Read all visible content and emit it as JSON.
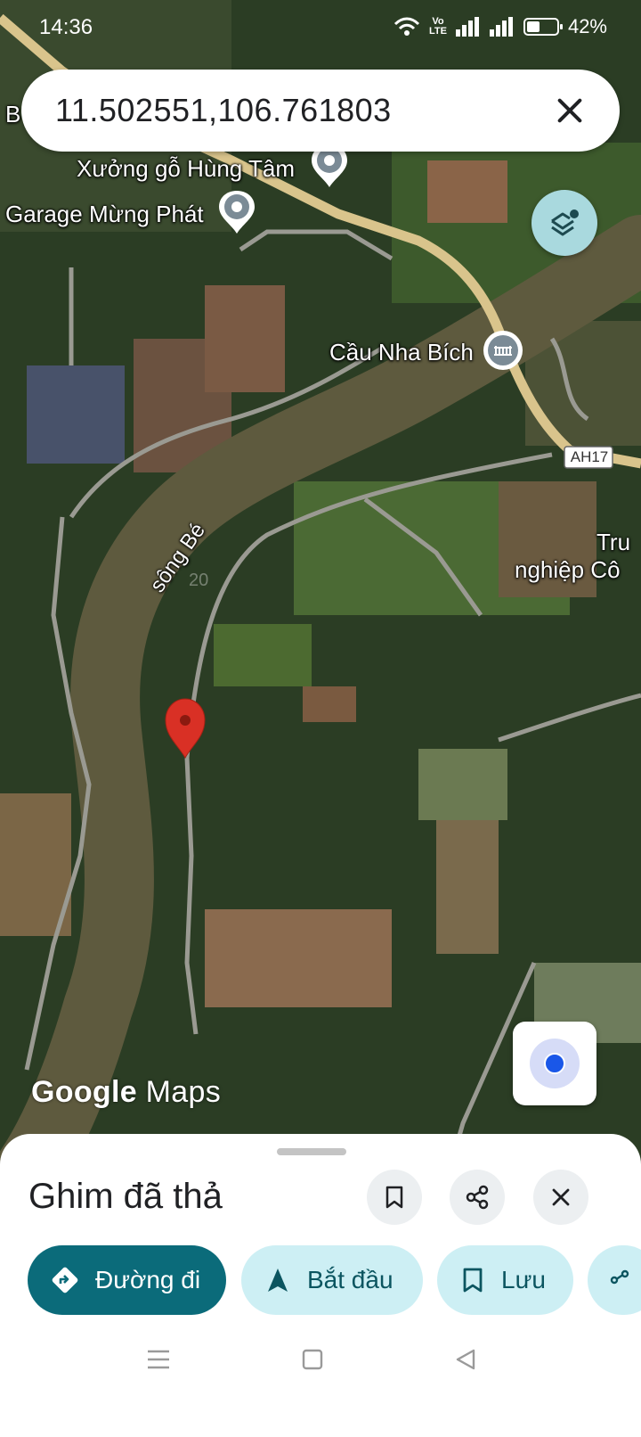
{
  "status_bar": {
    "time": "14:36",
    "network": "Vo\nLTE",
    "battery": "42%"
  },
  "search": {
    "query": "11.502551,106.761803"
  },
  "map": {
    "labels": {
      "poi_workshop": "Xưởng gỗ Hùng Tâm",
      "poi_garage": "Garage Mừng Phát",
      "poi_bridge": "Cầu Nha Bích",
      "river": "sông Bé",
      "road_shield": "AH17",
      "area_1": "Tru",
      "area_2": "nghiệp Cô",
      "edge_letter": "B",
      "faint_mark": "20"
    },
    "watermark": {
      "google": "Google",
      "maps": "Maps"
    }
  },
  "sheet": {
    "title": "Ghim đã thả",
    "chips": {
      "directions": "Đường đi",
      "start": "Bắt đầu",
      "save": "Lưu"
    }
  },
  "colors": {
    "accent": "#0b6b7a",
    "chip_light": "#cdeff4",
    "pin": "#d93025"
  }
}
